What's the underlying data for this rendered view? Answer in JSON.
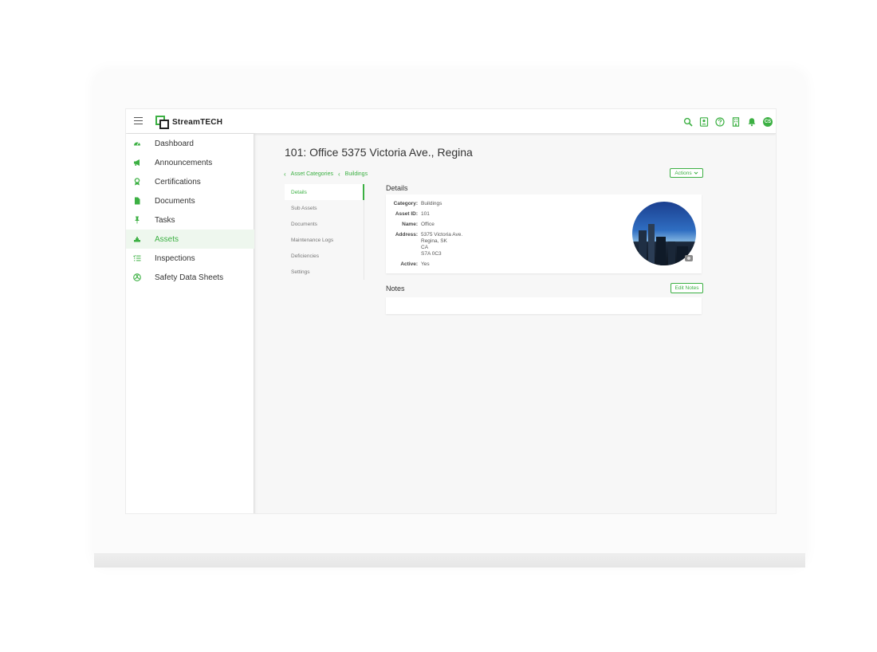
{
  "app": {
    "logo_text": "StreamTECH",
    "accent_color": "#3cb043"
  },
  "topbar": {
    "icons": [
      "search-icon",
      "contact-icon",
      "help-icon",
      "building-icon",
      "bell-icon"
    ],
    "avatar_initials": "CS"
  },
  "sidebar": {
    "items": [
      {
        "label": "Dashboard",
        "icon": "dashboard-icon"
      },
      {
        "label": "Announcements",
        "icon": "megaphone-icon"
      },
      {
        "label": "Certifications",
        "icon": "award-icon"
      },
      {
        "label": "Documents",
        "icon": "document-icon"
      },
      {
        "label": "Tasks",
        "icon": "pin-icon"
      },
      {
        "label": "Assets",
        "icon": "assets-icon",
        "active": true
      },
      {
        "label": "Inspections",
        "icon": "checklist-icon"
      },
      {
        "label": "Safety Data Sheets",
        "icon": "hazard-icon"
      }
    ]
  },
  "main": {
    "title": "101: Office 5375 Victoria Ave., Regina",
    "breadcrumb": [
      "Asset Categories",
      "Buildings"
    ],
    "actions_label": "Actions",
    "subnav": [
      "Details",
      "Sub Assets",
      "Documents",
      "Maintenance Logs",
      "Deficiencies",
      "Settings"
    ],
    "details_heading": "Details",
    "details": {
      "category_label": "Category:",
      "category": "Buildings",
      "asset_id_label": "Asset ID:",
      "asset_id": "101",
      "name_label": "Name:",
      "name": "Office",
      "address_label": "Address:",
      "address_lines": [
        "5375 Victoria Ave.",
        "Regina, SK",
        "CA",
        "S7A 0C3"
      ],
      "active_label": "Active:",
      "active": "Yes"
    },
    "notes_heading": "Notes",
    "edit_notes_label": "Edit Notes"
  }
}
